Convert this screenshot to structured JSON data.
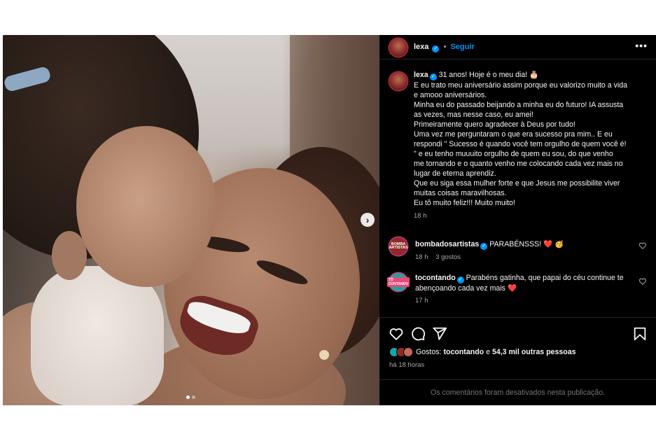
{
  "post": {
    "author": "lexa",
    "follow_label": "Seguir",
    "separator": "•",
    "more_label": "•••",
    "caption": {
      "lines": [
        "31 anos! Hoje é o meu dia! 🎂",
        "E eu trato meu aniversário assim porque eu valorizo muito a vida",
        "e amooo aniversários.",
        "Minha eu do passado beijando a minha eu do futuro! IA assusta",
        "as vezes, mas nesse caso, eu amei!",
        "Primeiramente quero agradecer à Deus por tudo!",
        "Uma vez me perguntaram o que era sucesso pra mim.. E eu",
        "respondi \" Sucesso é quando você tem orgulho de quem você é!",
        "\" e eu tenho muuuito orgulho de quem eu sou, do que venho",
        "me tornando e o quanto venho me colocando cada vez mais no",
        "lugar de eterna aprendiz.",
        "Que eu siga essa mulher forte e que Jesus me possibilite viver",
        "muitas coisas maravilhosas.",
        "Eu tô muito feliz!!! Muito muito!"
      ],
      "time": "18 h"
    },
    "comments": [
      {
        "user": "bombadosartistas",
        "text": "PARABÉNSSS!",
        "emoji": "❤️ 🥳",
        "time": "18 h",
        "likes": "3 gostos",
        "avatar_text": "BOMBA ARTISTAS"
      },
      {
        "user": "tocontando",
        "text_line1": "Parabéns gatinha, que papai do céu continue te",
        "text_line2": "abençoando cada vez mais",
        "emoji": "❤️",
        "time": "17 h",
        "avatar_text": "TÔ CONTANDO"
      }
    ],
    "likes": {
      "prefix": "Gostos:",
      "user": "tocontando",
      "connector": "e",
      "others": "54,3 mil outras pessoas"
    },
    "posted": "há 18 horas",
    "comments_disabled": "Os comentários foram desativados nesta publicação.",
    "carousel": {
      "next_label": "›",
      "count": 2,
      "active_index": 0
    }
  },
  "colors": {
    "background": "#000000",
    "text": "#f5f5f5",
    "secondary": "#a8a8a8",
    "link": "#0095f6",
    "verified": "#0095f6",
    "heart": "#ed4956"
  },
  "icons": [
    "more-icon",
    "verified-icon",
    "heart-icon",
    "comment-icon",
    "share-icon",
    "bookmark-icon",
    "chevron-right-icon"
  ]
}
